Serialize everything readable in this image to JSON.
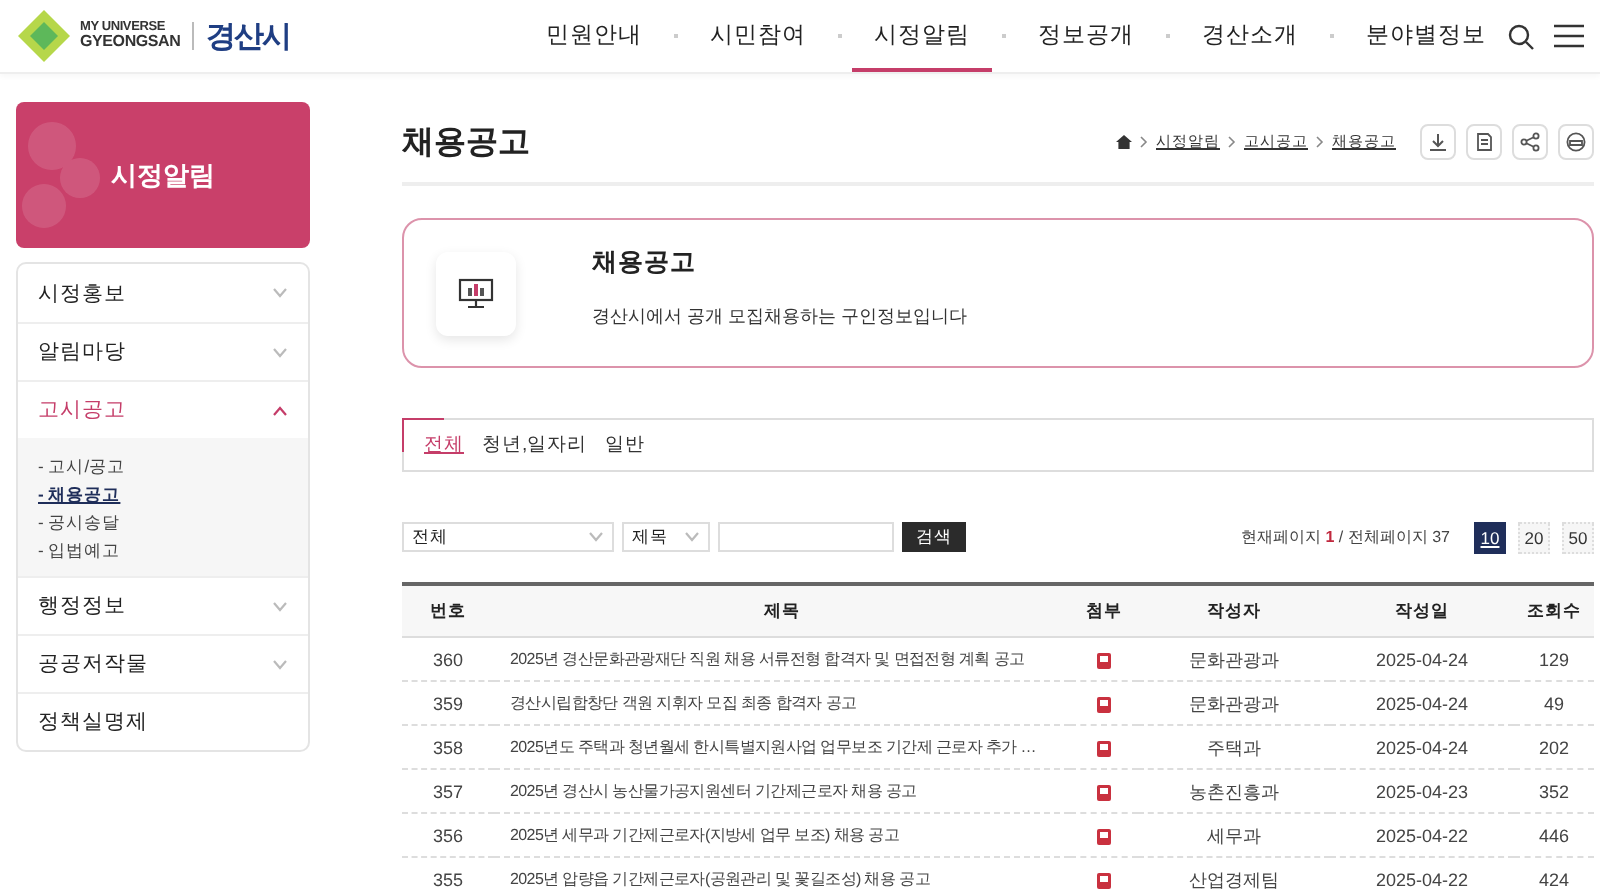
{
  "header": {
    "logo": {
      "tagline": "MY UNIVERSE",
      "name": "GYEONGSAN",
      "city": "경산시"
    },
    "nav": [
      {
        "label": "민원안내",
        "selected": false
      },
      {
        "label": "시민참여",
        "selected": false
      },
      {
        "label": "시정알림",
        "selected": true
      },
      {
        "label": "정보공개",
        "selected": false
      },
      {
        "label": "경산소개",
        "selected": false
      },
      {
        "label": "분야별정보",
        "selected": false
      }
    ]
  },
  "sidebar": {
    "title": "시정알림",
    "menu": [
      {
        "label": "시정홍보",
        "expandable": true,
        "expanded": false
      },
      {
        "label": "알림마당",
        "expandable": true,
        "expanded": false
      },
      {
        "label": "고시공고",
        "expandable": true,
        "expanded": true,
        "children": [
          {
            "label": "- 고시/공고",
            "selected": false
          },
          {
            "label": "- 채용공고",
            "selected": true
          },
          {
            "label": "- 공시송달",
            "selected": false
          },
          {
            "label": "- 입법예고",
            "selected": false
          }
        ]
      },
      {
        "label": "행정정보",
        "expandable": true,
        "expanded": false
      },
      {
        "label": "공공저작물",
        "expandable": true,
        "expanded": false
      },
      {
        "label": "정책실명제",
        "expandable": false,
        "expanded": false
      }
    ]
  },
  "page": {
    "title": "채용공고",
    "breadcrumb": [
      "시정알림",
      "고시공고",
      "채용공고"
    ]
  },
  "info": {
    "title": "채용공고",
    "description": "경산시에서 공개 모집채용하는 구인정보입니다"
  },
  "tabs": [
    {
      "label": "전체",
      "selected": true
    },
    {
      "label": "청년,일자리",
      "selected": false
    },
    {
      "label": "일반",
      "selected": false
    }
  ],
  "search": {
    "category": "전체",
    "field": "제목",
    "button": "검색"
  },
  "paging": {
    "info": "현재페이지 **1** / 전체페이지 37",
    "sizes": [
      {
        "label": "10",
        "selected": true
      },
      {
        "label": "20",
        "selected": false
      },
      {
        "label": "50",
        "selected": false
      }
    ]
  },
  "table": {
    "columns": [
      "번호",
      "제목",
      "첨부",
      "작성자",
      "작성일",
      "조회수"
    ],
    "rows": [
      {
        "no": "360",
        "title": "2025년 경산문화관광재단 직원 채용 서류전형 합격자 및 면접전형 계획 공고",
        "attachment": true,
        "author": "문화관광과",
        "date": "2025-04-24",
        "views": "129"
      },
      {
        "no": "359",
        "title": "경산시립합창단 객원 지휘자 모집 최종 합격자 공고",
        "attachment": true,
        "author": "문화관광과",
        "date": "2025-04-24",
        "views": "49"
      },
      {
        "no": "358",
        "title": "2025년도 주택과 청년월세 한시특별지원사업 업무보조 기간제 근로자 추가 …",
        "attachment": true,
        "author": "주택과",
        "date": "2025-04-24",
        "views": "202"
      },
      {
        "no": "357",
        "title": "2025년 경산시 농산물가공지원센터 기간제근로자 채용 공고",
        "attachment": true,
        "author": "농촌진흥과",
        "date": "2025-04-23",
        "views": "352"
      },
      {
        "no": "356",
        "title": "2025년 세무과 기간제근로자(지방세 업무 보조) 채용 공고",
        "attachment": true,
        "author": "세무과",
        "date": "2025-04-22",
        "views": "446"
      },
      {
        "no": "355",
        "title": "2025년 압량읍 기간제근로자(공원관리 및 꽃길조성) 채용 공고",
        "attachment": true,
        "author": "산업경제팀",
        "date": "2025-04-22",
        "views": "424"
      }
    ]
  }
}
